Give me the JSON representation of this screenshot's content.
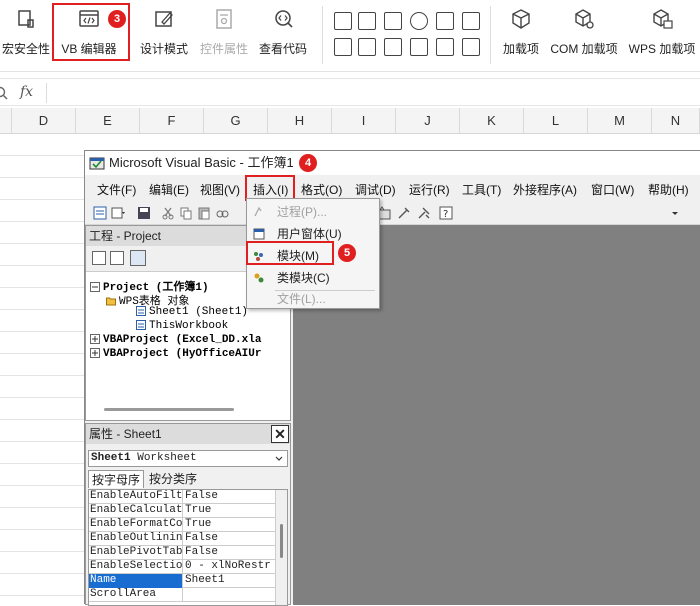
{
  "ribbon": {
    "macro_security": "宏安全性",
    "vb_editor": "VB 编辑器",
    "design_mode": "设计模式",
    "control_properties": "控件属性",
    "view_code": "查看代码",
    "addins": "加载项",
    "com_addins": "COM 加载项",
    "wps_addins": "WPS 加载项"
  },
  "formula_bar": {
    "fx": "fx"
  },
  "columns": [
    "D",
    "E",
    "F",
    "G",
    "H",
    "I",
    "J",
    "K",
    "L",
    "M",
    "N"
  ],
  "callouts": [
    "3",
    "4",
    "5"
  ],
  "vbe": {
    "title": "Microsoft Visual Basic - 工作簿1",
    "menu": [
      "文件(F)",
      "编辑(E)",
      "视图(V)",
      "插入(I)",
      "格式(O)",
      "调试(D)",
      "运行(R)",
      "工具(T)",
      "外接程序(A)",
      "窗口(W)",
      "帮助(H)"
    ],
    "project_panel": {
      "title": "工程 - Project",
      "tree": [
        "Project (工作簿1)",
        "WPS表格 对象",
        "Sheet1 (Sheet1)",
        "ThisWorkbook",
        "VBAProject (Excel_DD.xla",
        "VBAProject (HyOfficeAIUr"
      ]
    },
    "properties_panel": {
      "title": "属性 - Sheet1",
      "close": "✕",
      "object": "Sheet1",
      "object_type": "Worksheet",
      "tabs": [
        "按字母序",
        "按分类序"
      ],
      "rows": [
        {
          "name": "EnableAutoFilt",
          "value": "False"
        },
        {
          "name": "EnableCalculat",
          "value": "True"
        },
        {
          "name": "EnableFormatCo",
          "value": "True"
        },
        {
          "name": "EnableOutlinin",
          "value": "False"
        },
        {
          "name": "EnablePivotTab",
          "value": "False"
        },
        {
          "name": "EnableSelectio",
          "value": "0 - xlNoRestr"
        },
        {
          "name": "Name",
          "value": "Sheet1"
        },
        {
          "name": "ScrollArea",
          "value": ""
        }
      ]
    },
    "insert_menu": {
      "items": [
        "过程(P)...",
        "用户窗体(U)",
        "模块(M)",
        "类模块(C)",
        "文件(L)..."
      ]
    }
  }
}
